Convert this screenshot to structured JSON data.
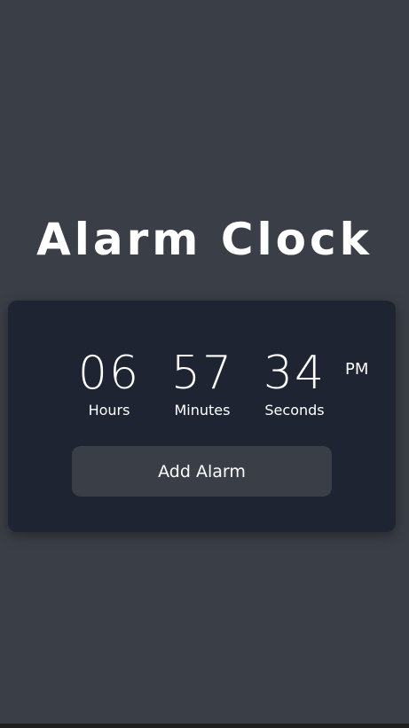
{
  "page": {
    "title": "Alarm Clock"
  },
  "clock": {
    "hours": "06",
    "minutes": "57",
    "seconds": "34",
    "meridiem": "PM",
    "labels": {
      "hours": "Hours",
      "minutes": "Minutes",
      "seconds": "Seconds"
    }
  },
  "actions": {
    "add_alarm_label": "Add Alarm"
  },
  "colors": {
    "background": "#3a3e46",
    "card": "#1e2432",
    "button": "#3a3e46",
    "text": "#ffffff"
  }
}
